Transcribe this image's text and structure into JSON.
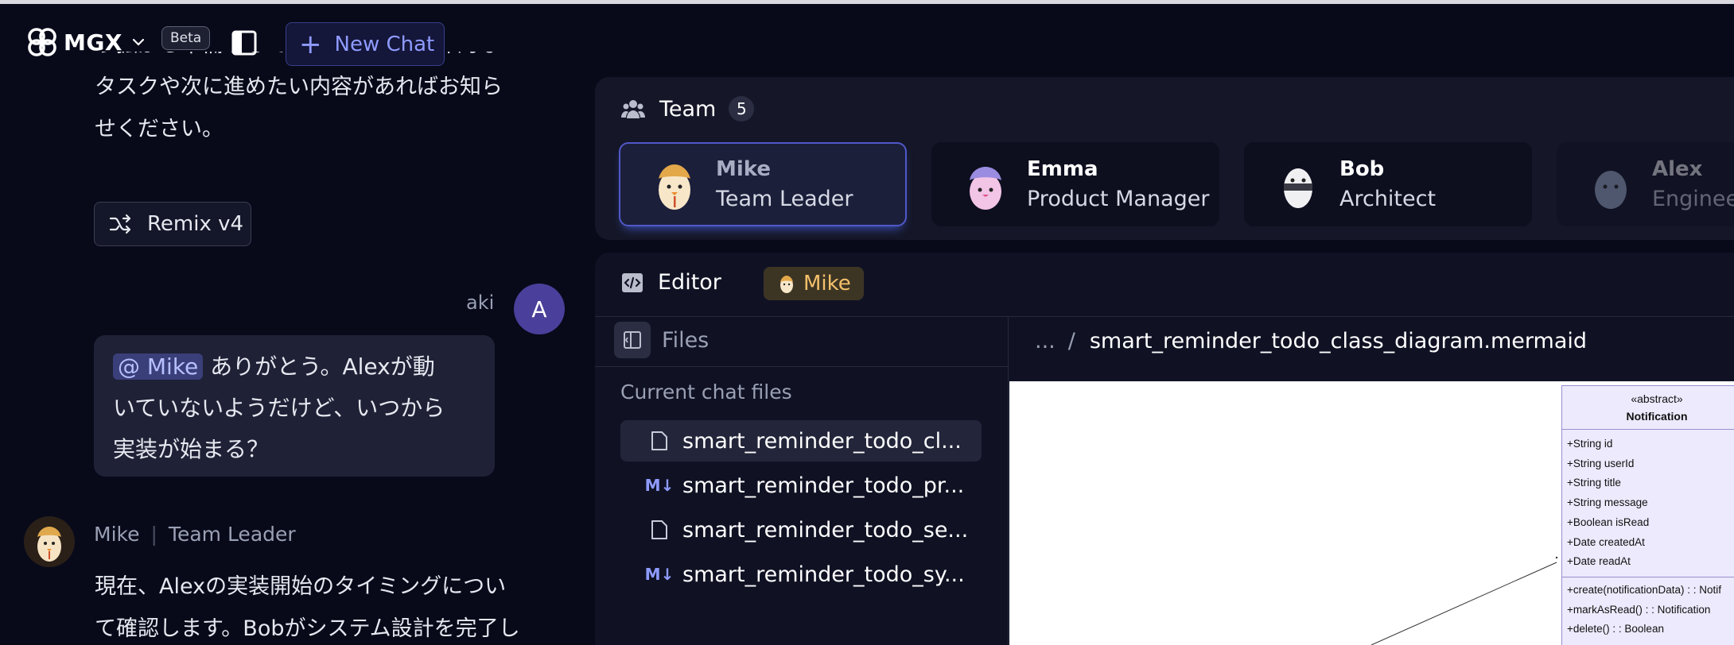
{
  "header": {
    "brand": "MGX",
    "beta_label": "Beta",
    "new_chat_label": "New Chat"
  },
  "chat": {
    "prev_message_lines": [
      "う拡がる準備をしています。もし具体的な",
      "タスクや次に進めたい内容があればお知ら",
      "せください。"
    ],
    "remix_label": "Remix v4",
    "user": {
      "name": "aki",
      "avatar_letter": "A",
      "mention": "@ Mike",
      "lines": [
        " ありがとう。Alexが動",
        "いていないようだけど、いつから",
        "実装が始まる？"
      ]
    },
    "reply": {
      "name": "Mike",
      "role": "Team Leader",
      "lines": [
        "現在、Alexの実装開始のタイミングについ",
        "て確認します。Bobがシステム設計を完了し"
      ]
    }
  },
  "team": {
    "title": "Team",
    "count": "5",
    "members": [
      {
        "name": "Mike",
        "role": "Team Leader"
      },
      {
        "name": "Emma",
        "role": "Product Manager"
      },
      {
        "name": "Bob",
        "role": "Architect"
      },
      {
        "name": "Alex",
        "role": "Engineer"
      }
    ]
  },
  "editor": {
    "title": "Editor",
    "agent_chip": "Mike",
    "files_label": "Files",
    "current_files_label": "Current chat files",
    "files": [
      {
        "name": "smart_reminder_todo_cl...",
        "icon": "file-icon"
      },
      {
        "name": "smart_reminder_todo_pr...",
        "icon": "markdown-icon"
      },
      {
        "name": "smart_reminder_todo_se...",
        "icon": "file-icon"
      },
      {
        "name": "smart_reminder_todo_sy...",
        "icon": "markdown-icon"
      }
    ],
    "breadcrumb_ellipsis": "...",
    "breadcrumb_sep": "/",
    "breadcrumb_file": "smart_reminder_todo_class_diagram.mermaid"
  },
  "diagram": {
    "stereotype": "«abstract»",
    "class_name": "Notification",
    "attributes": [
      "+String id",
      "+String userId",
      "+String title",
      "+String message",
      "+Boolean isRead",
      "+Date createdAt",
      "+Date readAt"
    ],
    "methods": [
      "+create(notificationData) : : Notif",
      "+markAsRead() : : Notification",
      "+delete() : : Boolean"
    ]
  },
  "colors": {
    "background": "#080a1a",
    "accent": "#8f9bff",
    "mike_chip": "#f3c06a"
  }
}
